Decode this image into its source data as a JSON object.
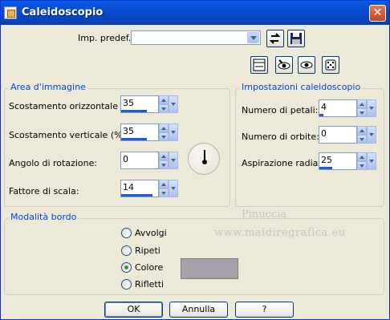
{
  "window": {
    "title": "Caleidoscopio"
  },
  "preset": {
    "label": "Imp. predef.:",
    "value": ""
  },
  "area": {
    "title": "Area d'immagine",
    "fields": [
      {
        "label": "Scostamento orizzontale (%):",
        "value": "35",
        "fill_percent": 70
      },
      {
        "label": "Scostamento verticale (%):",
        "value": "35",
        "fill_percent": 70
      },
      {
        "label": "Angolo di rotazione:",
        "value": "0",
        "fill_percent": 0
      },
      {
        "label": "Fattore di scala:",
        "value": "14",
        "fill_percent": 85
      }
    ]
  },
  "settings": {
    "title": "Impostazioni caleidoscopio",
    "fields": [
      {
        "label": "Numero di petali:",
        "value": "4",
        "fill_percent": 10
      },
      {
        "label": "Numero di orbite:",
        "value": "0",
        "fill_percent": 0
      },
      {
        "label": "Aspirazione radiale:",
        "value": "25",
        "fill_percent": 35
      }
    ]
  },
  "border_mode": {
    "title": "Modalità bordo",
    "options": [
      {
        "label": "Avvolgi",
        "selected": false
      },
      {
        "label": "Ripeti",
        "selected": false
      },
      {
        "label": "Colore",
        "selected": true
      },
      {
        "label": "Rifletti",
        "selected": false
      }
    ],
    "color": "#a8a0a8"
  },
  "watermark": {
    "line1": "Pinuccia",
    "line2": "www.maidiregrafica.eu"
  },
  "buttons": {
    "ok": "OK",
    "cancel": "Annulla",
    "help": "?"
  },
  "icons": [
    "app-icon",
    "close-icon",
    "reset-preset-icon",
    "save-preset-icon",
    "proof-icon",
    "eye-toggle-icon",
    "eye-preview-icon",
    "randomize-dice-icon"
  ]
}
